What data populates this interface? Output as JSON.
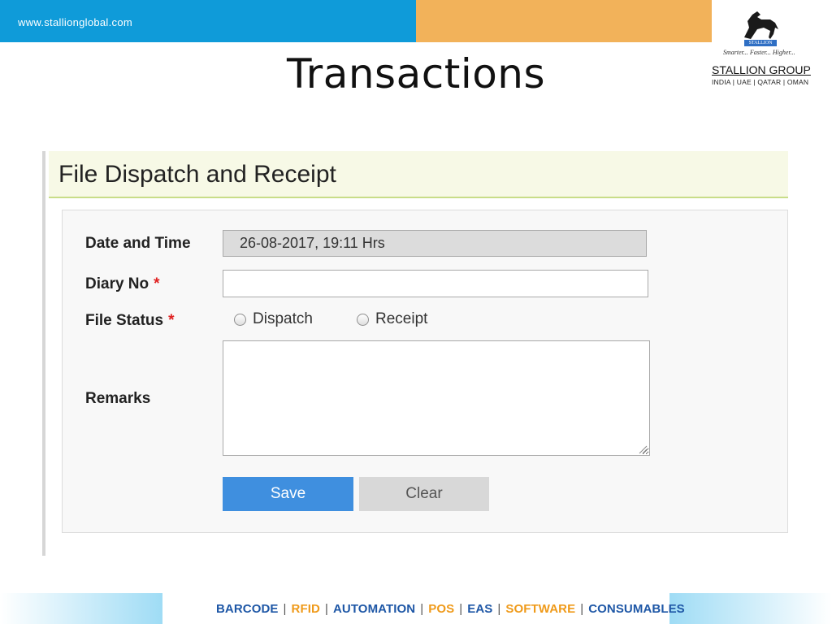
{
  "header": {
    "url": "www.stallionglobal.com",
    "slide_title": "Transactions"
  },
  "logo": {
    "badge": "STALLION",
    "tagline": "Smarter... Faster... Higher...",
    "name": "STALLION GROUP",
    "countries": "INDIA | UAE | QATAR | OMAN"
  },
  "form": {
    "title": "File Dispatch and Receipt",
    "date_label": "Date and Time",
    "date_value": "26-08-2017, 19:11 Hrs",
    "diary_label": "Diary No",
    "diary_value": "",
    "required_mark": "*",
    "status_label": "File Status",
    "status_options": [
      "Dispatch",
      "Receipt"
    ],
    "remarks_label": "Remarks",
    "remarks_value": "",
    "save_label": "Save",
    "clear_label": "Clear"
  },
  "footer": {
    "items": [
      "BARCODE",
      "RFID",
      "AUTOMATION",
      "POS",
      "EAS",
      "SOFTWARE",
      "CONSUMABLES"
    ],
    "separator": "|"
  },
  "colors": {
    "top_blue": "#0f9bd9",
    "top_orange": "#f2b25a",
    "save_button": "#3f8fdf",
    "footer_blue": "#1e57a6",
    "footer_orange": "#ef9a1a"
  }
}
